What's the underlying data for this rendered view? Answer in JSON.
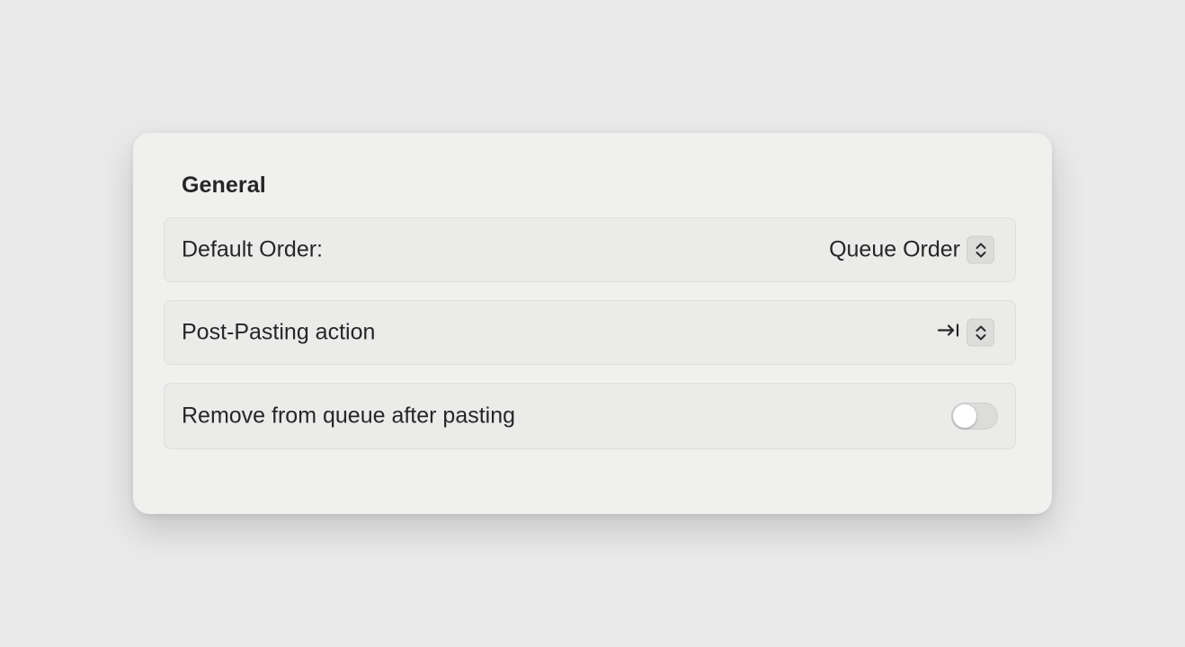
{
  "section": {
    "title": "General"
  },
  "settings": {
    "default_order": {
      "label": "Default Order:",
      "value": "Queue Order",
      "control_icon": "chevron-up-down-icon"
    },
    "post_pasting_action": {
      "label": "Post-Pasting action",
      "value_icon": "tab-right-icon",
      "control_icon": "chevron-up-down-icon"
    },
    "remove_after_pasting": {
      "label": "Remove from queue after pasting",
      "enabled": false
    }
  },
  "colors": {
    "background": "#eaeaea",
    "panel": "#f0f0ef",
    "row": "#ebebea",
    "text": "#262626"
  }
}
